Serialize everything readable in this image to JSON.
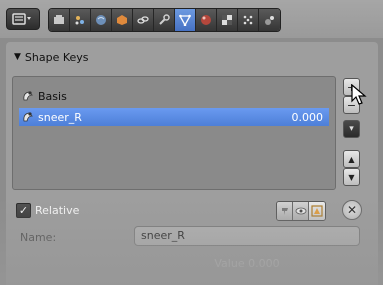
{
  "header": {
    "editor_icon": "properties-editor-icon",
    "tabs": [
      {
        "icon": "render-icon",
        "active": false
      },
      {
        "icon": "scene-icon",
        "active": false
      },
      {
        "icon": "world-icon",
        "active": false
      },
      {
        "icon": "object-icon",
        "active": false
      },
      {
        "icon": "constraints-icon",
        "active": false
      },
      {
        "icon": "modifiers-wrench-icon",
        "active": false
      },
      {
        "icon": "object-data-mesh-icon",
        "active": true
      },
      {
        "icon": "material-icon",
        "active": false
      },
      {
        "icon": "texture-icon",
        "active": false
      },
      {
        "icon": "particles-icon",
        "active": false
      },
      {
        "icon": "physics-icon",
        "active": false
      }
    ]
  },
  "panel": {
    "title": "Shape Keys",
    "list": [
      {
        "name": "Basis",
        "value": "",
        "selected": false
      },
      {
        "name": "sneer_R",
        "value": "0.000",
        "selected": true
      }
    ],
    "side_buttons": {
      "add": "+",
      "remove": "−",
      "menu": "▾",
      "move_up": "▲",
      "move_down": "▼"
    },
    "relative_label": "Relative",
    "relative_checked": true,
    "name_label": "Name:",
    "name_value": "sneer_R",
    "value_text": "Value 0.000"
  },
  "colors": {
    "selection": "#5b8de4",
    "active_tab": "#5a86d2"
  }
}
